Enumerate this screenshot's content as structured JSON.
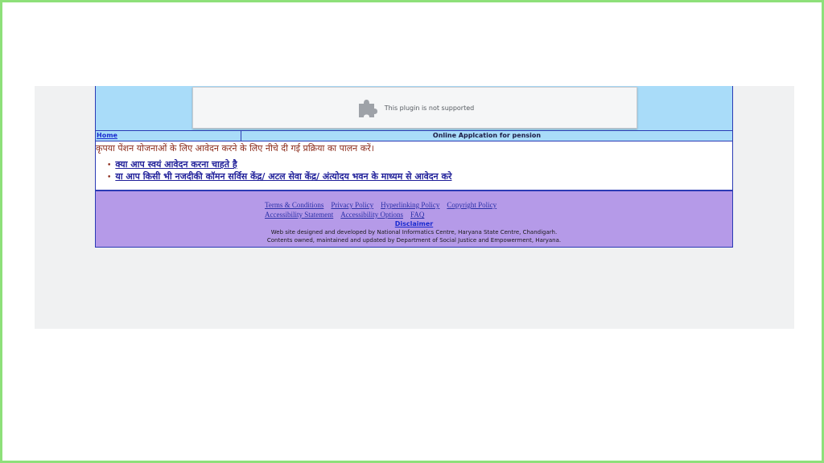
{
  "plugin": {
    "message": "This plugin is not supported",
    "icon": "puzzle-piece-icon"
  },
  "nav": {
    "home_label": "Home",
    "title": "Online Applcation for pension"
  },
  "content": {
    "instruction": "कृपया पेंशन योजनाओं के लिए आवेदन करने के लिए नीचे दी गई प्रक्रिया का पालन करें।",
    "options": [
      {
        "label": "क्या आप स्वयं आवेदन करना चाहते है"
      },
      {
        "label": "या आप किसी भी नजदीकी कॉमन सर्विस केंद्र/ अटल सेवा केंद्र/ अंत्योदय भवन के माध्यम से आवेदन करे"
      }
    ]
  },
  "footer": {
    "links": [
      "Terms & Conditions",
      "Privacy Policy",
      "Hyperlinking Policy",
      "Copyright Policy",
      "Accessibility Statement",
      "Accessibility Options",
      "FAQ"
    ],
    "disclaimer": "Disclaimer",
    "credit_line1": "Web site designed and developed by National Informatics Centre, Haryana State Centre, Chandigarh.",
    "credit_line2": "Contents owned, maintained and updated by Department of Social Justice and Empowerment, Haryana."
  },
  "colors": {
    "frame_border": "#8ee07a",
    "banner_bg": "#a9dcf9",
    "footer_bg": "#b59ae8",
    "border_blue": "#2b3bb5",
    "instruction_text": "#8b2b1a",
    "link_blue": "#1f1f99"
  }
}
